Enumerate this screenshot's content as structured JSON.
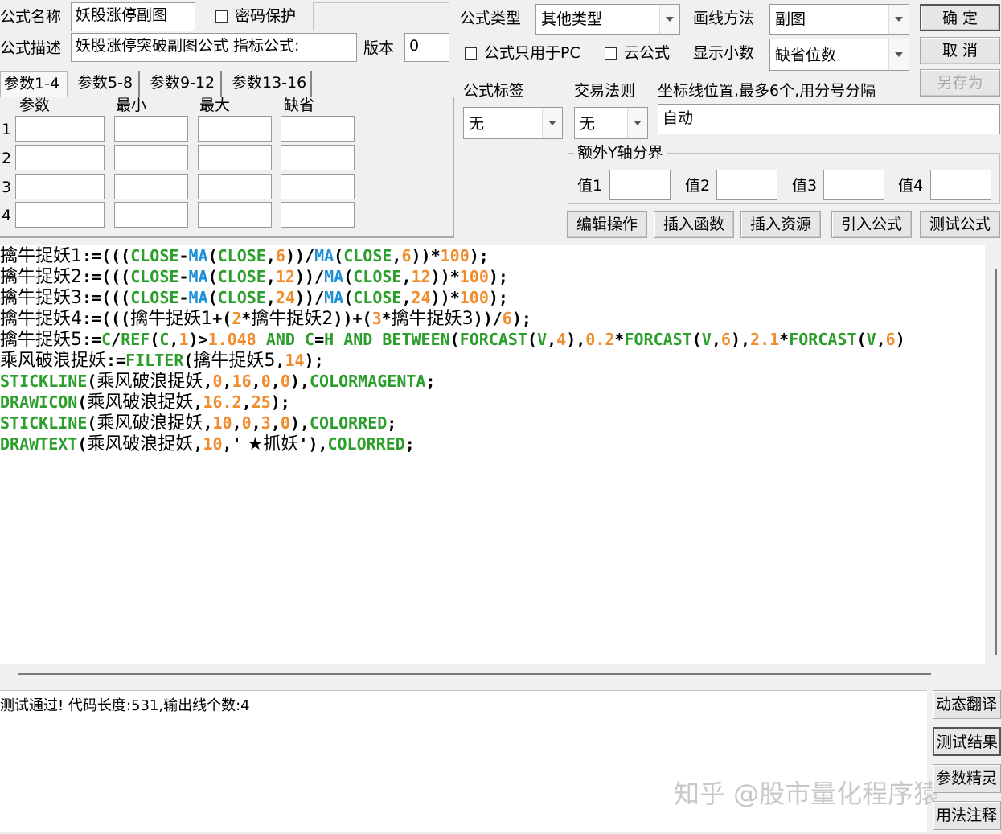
{
  "form": {
    "name_label": "公式名称",
    "name_value": "妖股涨停副图",
    "password_label": "密码保护",
    "type_label": "公式类型",
    "type_value": "其他类型",
    "draw_label": "画线方法",
    "draw_value": "副图",
    "desc_label": "公式描述",
    "desc_value": "妖股涨停突破副图公式 指标公式:",
    "version_label": "版本",
    "version_value": "0",
    "pc_only_label": "公式只用于PC",
    "cloud_label": "云公式",
    "decimal_label": "显示小数",
    "decimal_value": "缺省位数",
    "tag_label": "公式标签",
    "tag_value": "无",
    "rule_label": "交易法则",
    "rule_value": "无",
    "coord_label": "坐标线位置,最多6个,用分号分隔",
    "coord_value": "自动",
    "yaxis_label": "额外Y轴分界",
    "y_labels": [
      "值1",
      "值2",
      "值3",
      "值4"
    ]
  },
  "buttons": {
    "ok": "确 定",
    "cancel": "取 消",
    "save_as": "另存为",
    "edit": "编辑操作",
    "insert_func": "插入函数",
    "insert_res": "插入资源",
    "import": "引入公式",
    "test": "测试公式"
  },
  "tabs": [
    "参数1-4",
    "参数5-8",
    "参数9-12",
    "参数13-16"
  ],
  "params": {
    "headers": [
      "参数",
      "最小",
      "最大",
      "缺省"
    ],
    "rows": [
      "1",
      "2",
      "3",
      "4"
    ]
  },
  "code_lines": [
    [
      [
        "v",
        "擒牛捉妖1"
      ],
      [
        "o",
        ":=((("
      ],
      [
        "k",
        "CLOSE"
      ],
      [
        "o",
        "-"
      ],
      [
        "f",
        "MA"
      ],
      [
        "o",
        "("
      ],
      [
        "k",
        "CLOSE"
      ],
      [
        "o",
        ","
      ],
      [
        "n",
        "6"
      ],
      [
        "o",
        "))/"
      ],
      [
        "f",
        "MA"
      ],
      [
        "o",
        "("
      ],
      [
        "k",
        "CLOSE"
      ],
      [
        "o",
        ","
      ],
      [
        "n",
        "6"
      ],
      [
        "o",
        "))*"
      ],
      [
        "n",
        "100"
      ],
      [
        "o",
        ");"
      ]
    ],
    [
      [
        "v",
        "擒牛捉妖2"
      ],
      [
        "o",
        ":=((("
      ],
      [
        "k",
        "CLOSE"
      ],
      [
        "o",
        "-"
      ],
      [
        "f",
        "MA"
      ],
      [
        "o",
        "("
      ],
      [
        "k",
        "CLOSE"
      ],
      [
        "o",
        ","
      ],
      [
        "n",
        "12"
      ],
      [
        "o",
        "))/"
      ],
      [
        "f",
        "MA"
      ],
      [
        "o",
        "("
      ],
      [
        "k",
        "CLOSE"
      ],
      [
        "o",
        ","
      ],
      [
        "n",
        "12"
      ],
      [
        "o",
        "))*"
      ],
      [
        "n",
        "100"
      ],
      [
        "o",
        ");"
      ]
    ],
    [
      [
        "v",
        "擒牛捉妖3"
      ],
      [
        "o",
        ":=((("
      ],
      [
        "k",
        "CLOSE"
      ],
      [
        "o",
        "-"
      ],
      [
        "f",
        "MA"
      ],
      [
        "o",
        "("
      ],
      [
        "k",
        "CLOSE"
      ],
      [
        "o",
        ","
      ],
      [
        "n",
        "24"
      ],
      [
        "o",
        "))/"
      ],
      [
        "f",
        "MA"
      ],
      [
        "o",
        "("
      ],
      [
        "k",
        "CLOSE"
      ],
      [
        "o",
        ","
      ],
      [
        "n",
        "24"
      ],
      [
        "o",
        "))*"
      ],
      [
        "n",
        "100"
      ],
      [
        "o",
        ");"
      ]
    ],
    [
      [
        "v",
        "擒牛捉妖4"
      ],
      [
        "o",
        ":=((("
      ],
      [
        "v",
        "擒牛捉妖1"
      ],
      [
        "o",
        "+("
      ],
      [
        "n",
        "2"
      ],
      [
        "o",
        "*"
      ],
      [
        "v",
        "擒牛捉妖2"
      ],
      [
        "o",
        "))+("
      ],
      [
        "n",
        "3"
      ],
      [
        "o",
        "*"
      ],
      [
        "v",
        "擒牛捉妖3"
      ],
      [
        "o",
        "))/"
      ],
      [
        "n",
        "6"
      ],
      [
        "o",
        ");"
      ]
    ],
    [
      [
        "v",
        "擒牛捉妖5"
      ],
      [
        "o",
        ":="
      ],
      [
        "k",
        "C"
      ],
      [
        "o",
        "/"
      ],
      [
        "k",
        "REF"
      ],
      [
        "o",
        "("
      ],
      [
        "k",
        "C"
      ],
      [
        "o",
        ","
      ],
      [
        "n",
        "1"
      ],
      [
        "o",
        ")>"
      ],
      [
        "n",
        "1.048"
      ],
      [
        "k",
        " AND "
      ],
      [
        "k",
        "C"
      ],
      [
        "o",
        "="
      ],
      [
        "k",
        "H"
      ],
      [
        "k",
        " AND BETWEEN"
      ],
      [
        "o",
        "("
      ],
      [
        "k",
        "FORCAST"
      ],
      [
        "o",
        "("
      ],
      [
        "k",
        "V"
      ],
      [
        "o",
        ","
      ],
      [
        "n",
        "4"
      ],
      [
        "o",
        "),"
      ],
      [
        "n",
        "0.2"
      ],
      [
        "o",
        "*"
      ],
      [
        "k",
        "FORCAST"
      ],
      [
        "o",
        "("
      ],
      [
        "k",
        "V"
      ],
      [
        "o",
        ","
      ],
      [
        "n",
        "6"
      ],
      [
        "o",
        "),"
      ],
      [
        "n",
        "2.1"
      ],
      [
        "o",
        "*"
      ],
      [
        "k",
        "FORCAST"
      ],
      [
        "o",
        "("
      ],
      [
        "k",
        "V"
      ],
      [
        "o",
        ","
      ],
      [
        "n",
        "6"
      ],
      [
        "o",
        ")"
      ]
    ],
    [
      [
        "v",
        "乘风破浪捉妖"
      ],
      [
        "o",
        ":="
      ],
      [
        "k",
        "FILTER"
      ],
      [
        "o",
        "("
      ],
      [
        "v",
        "擒牛捉妖5"
      ],
      [
        "o",
        ","
      ],
      [
        "n",
        "14"
      ],
      [
        "o",
        ");"
      ]
    ],
    [
      [
        "k",
        "STICKLINE"
      ],
      [
        "o",
        "("
      ],
      [
        "v",
        "乘风破浪捉妖"
      ],
      [
        "o",
        ","
      ],
      [
        "n",
        "0"
      ],
      [
        "o",
        ","
      ],
      [
        "n",
        "16"
      ],
      [
        "o",
        ","
      ],
      [
        "n",
        "0"
      ],
      [
        "o",
        ","
      ],
      [
        "n",
        "0"
      ],
      [
        "o",
        "),"
      ],
      [
        "k",
        "COLORMAGENTA"
      ],
      [
        "o",
        ";"
      ]
    ],
    [
      [
        "k",
        "DRAWICON"
      ],
      [
        "o",
        "("
      ],
      [
        "v",
        "乘风破浪捉妖"
      ],
      [
        "o",
        ","
      ],
      [
        "n",
        "16.2"
      ],
      [
        "o",
        ","
      ],
      [
        "n",
        "25"
      ],
      [
        "o",
        ");"
      ]
    ],
    [
      [
        "k",
        "STICKLINE"
      ],
      [
        "o",
        "("
      ],
      [
        "v",
        "乘风破浪捉妖"
      ],
      [
        "o",
        ","
      ],
      [
        "n",
        "10"
      ],
      [
        "o",
        ","
      ],
      [
        "n",
        "0"
      ],
      [
        "o",
        ","
      ],
      [
        "n",
        "3"
      ],
      [
        "o",
        ","
      ],
      [
        "n",
        "0"
      ],
      [
        "o",
        "),"
      ],
      [
        "k",
        "COLORRED"
      ],
      [
        "o",
        ";"
      ]
    ],
    [
      [
        "k",
        "DRAWTEXT"
      ],
      [
        "o",
        "("
      ],
      [
        "v",
        "乘风破浪捉妖"
      ],
      [
        "o",
        ","
      ],
      [
        "n",
        "10"
      ],
      [
        "o",
        ",'"
      ],
      [
        "s",
        " ★抓妖"
      ],
      [
        "o",
        "'),"
      ],
      [
        "k",
        "COLORRED"
      ],
      [
        "o",
        ";"
      ]
    ]
  ],
  "status": {
    "message": "测试通过! 代码长度:531,输出线个数:4"
  },
  "side_buttons": [
    "动态翻译",
    "测试结果",
    "参数精灵",
    "用法注释"
  ],
  "watermark": "知乎 @股市量化程序猿"
}
